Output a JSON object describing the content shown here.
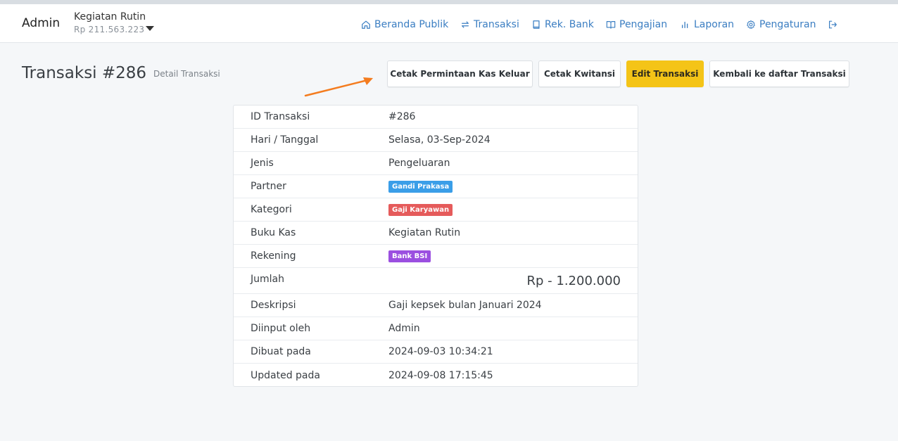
{
  "header": {
    "brand": "Admin",
    "book_name": "Kegiatan Rutin",
    "book_balance": "Rp 211.563.223",
    "nav": [
      {
        "label": "Beranda Publik",
        "icon": "home-icon"
      },
      {
        "label": "Transaksi",
        "icon": "exchange-icon"
      },
      {
        "label": "Rek. Bank",
        "icon": "book-icon"
      },
      {
        "label": "Pengajian",
        "icon": "open-book-icon"
      },
      {
        "label": "Laporan",
        "icon": "bar-chart-icon"
      },
      {
        "label": "Pengaturan",
        "icon": "gear-icon"
      }
    ],
    "logout_icon": "logout-icon"
  },
  "page": {
    "title": "Transaksi #286",
    "subtitle": "Detail Transaksi"
  },
  "actions": {
    "print_request": "Cetak Permintaan Kas Keluar",
    "print_receipt": "Cetak Kwitansi",
    "edit": "Edit Transaksi",
    "back": "Kembali ke daftar Transaksi"
  },
  "details": {
    "id": {
      "label": "ID Transaksi",
      "value": "#286"
    },
    "date": {
      "label": "Hari / Tanggal",
      "value": "Selasa, 03-Sep-2024"
    },
    "type": {
      "label": "Jenis",
      "value": "Pengeluaran"
    },
    "partner": {
      "label": "Partner",
      "value": "Gandi Prakasa"
    },
    "category": {
      "label": "Kategori",
      "value": "Gaji Karyawan"
    },
    "cashbook": {
      "label": "Buku Kas",
      "value": "Kegiatan Rutin"
    },
    "account": {
      "label": "Rekening",
      "value": "Bank BSI"
    },
    "amount": {
      "label": "Jumlah",
      "value": "Rp - 1.200.000"
    },
    "description": {
      "label": "Deskripsi",
      "value": "Gaji kepsek bulan Januari 2024"
    },
    "input_by": {
      "label": "Diinput oleh",
      "value": "Admin"
    },
    "created_at": {
      "label": "Dibuat pada",
      "value": "2024-09-03 10:34:21"
    },
    "updated_at": {
      "label": "Updated pada",
      "value": "2024-09-08 17:15:45"
    }
  },
  "colors": {
    "accent": "#3b7ec2",
    "edit_button": "#f4c417",
    "partner_badge": "#3a9ee8",
    "category_badge": "#e55b5b",
    "account_badge": "#9b4fe0",
    "annotation_arrow": "#f47c1f"
  }
}
